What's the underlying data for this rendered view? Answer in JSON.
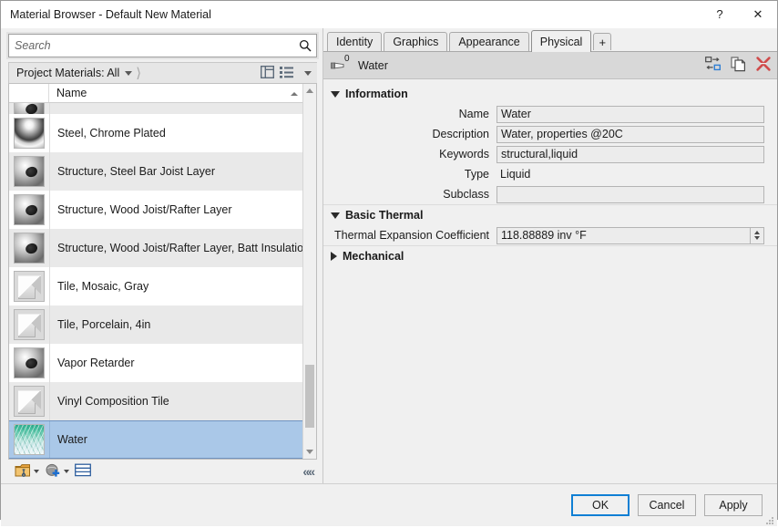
{
  "window": {
    "title": "Material Browser - Default New Material",
    "help_label": "?",
    "close_label": "✕"
  },
  "browser": {
    "search": {
      "placeholder": "Search",
      "value": "",
      "icon": "search-icon"
    },
    "filter": {
      "label": "Project Materials: All",
      "dropdown_icon": "caret-down-icon",
      "breadcrumb_icon": "chevron-right-icon",
      "view_panel_icon": "panel-layout-icon",
      "view_list_icon": "list-view-icon",
      "view_list_caret": "caret-down-icon"
    },
    "list": {
      "column_header": "Name",
      "sort_indicator": "sort-ascending-icon",
      "items": [
        {
          "name": "",
          "thumb": "sphere",
          "clipped": true,
          "selected": false
        },
        {
          "name": "Steel, Chrome Plated",
          "thumb": "chrome",
          "clipped": false,
          "selected": false
        },
        {
          "name": "Structure, Steel Bar Joist Layer",
          "thumb": "sphere",
          "clipped": false,
          "selected": false
        },
        {
          "name": "Structure, Wood Joist/Rafter Layer",
          "thumb": "sphere",
          "clipped": false,
          "selected": false
        },
        {
          "name": "Structure, Wood Joist/Rafter Layer, Batt Insulation",
          "thumb": "sphere",
          "clipped": false,
          "selected": false
        },
        {
          "name": "Tile, Mosaic, Gray",
          "thumb": "cube",
          "clipped": false,
          "selected": false
        },
        {
          "name": "Tile, Porcelain, 4in",
          "thumb": "cube",
          "clipped": false,
          "selected": false
        },
        {
          "name": "Vapor Retarder",
          "thumb": "sphere",
          "clipped": false,
          "selected": false
        },
        {
          "name": "Vinyl Composition Tile",
          "thumb": "cube",
          "clipped": false,
          "selected": false
        },
        {
          "name": "Water",
          "thumb": "water",
          "clipped": false,
          "selected": true
        }
      ]
    },
    "toolbar": {
      "library_icon": "material-library-icon",
      "library_caret": "caret-down-icon",
      "new_asset_icon": "new-asset-globe-icon",
      "new_asset_caret": "caret-down-icon",
      "show_panel_icon": "show-asset-browser-icon",
      "collapse_icon": "collapse-chevrons-icon",
      "collapse_label": "««"
    }
  },
  "editor": {
    "tabs": [
      {
        "label": "Identity",
        "active": false
      },
      {
        "label": "Graphics",
        "active": false
      },
      {
        "label": "Appearance",
        "active": false
      },
      {
        "label": "Physical",
        "active": true
      }
    ],
    "tab_add_label": "+",
    "asset": {
      "icon": "physical-asset-icon",
      "superscript": "0",
      "name": "Water",
      "tools": [
        {
          "name": "replace-asset-icon"
        },
        {
          "name": "duplicate-asset-icon"
        },
        {
          "name": "delete-asset-icon"
        }
      ]
    },
    "sections": [
      {
        "title": "Information",
        "expanded": true,
        "rows": [
          {
            "label": "Name",
            "value": "Water",
            "type": "input"
          },
          {
            "label": "Description",
            "value": "Water, properties @20C",
            "type": "input"
          },
          {
            "label": "Keywords",
            "value": "structural,liquid",
            "type": "input"
          },
          {
            "label": "Type",
            "value": "Liquid",
            "type": "static"
          },
          {
            "label": "Subclass",
            "value": "",
            "type": "input"
          }
        ]
      },
      {
        "title": "Basic Thermal",
        "expanded": true,
        "rows": [
          {
            "label": "Thermal Expansion Coefficient",
            "value": "118.88889 inv °F",
            "type": "spinner"
          }
        ]
      },
      {
        "title": "Mechanical",
        "expanded": false,
        "rows": []
      }
    ]
  },
  "footer": {
    "ok_label": "OK",
    "cancel_label": "Cancel",
    "apply_label": "Apply"
  },
  "colors": {
    "accent": "#0f7fd4",
    "selection": "#aac8e8",
    "header_bar": "#d8d8d8",
    "dialog_bg": "#f0f0f0",
    "delete_icon": "#d04a4a"
  }
}
